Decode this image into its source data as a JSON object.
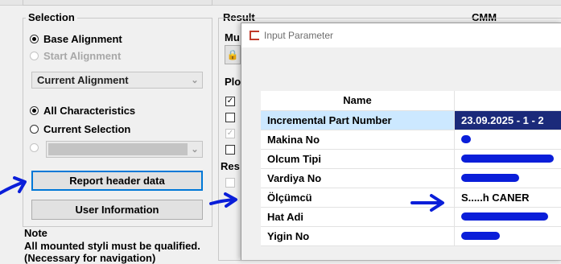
{
  "selection": {
    "title": "Selection",
    "base_alignment": "Base Alignment",
    "start_alignment": "Start Alignment",
    "alignment_combo": "Current Alignment",
    "all_characteristics": "All Characteristics",
    "current_selection": "Current Selection",
    "report_header_button": "Report header data",
    "user_info_button": "User Information"
  },
  "result": {
    "title": "Result",
    "mu_label": "Mu",
    "plot_label": "Plo",
    "res_label": "Res"
  },
  "cmm": {
    "title": "CMM"
  },
  "note": {
    "title": "Note",
    "line1": "All mounted styli must be qualified.",
    "line2": "(Necessary for navigation)"
  },
  "dialog": {
    "title": "Input Parameter",
    "header_name": "Name",
    "header_value": "",
    "rows": [
      {
        "name": "Incremental Part Number",
        "value": "23.09.2025 - 1 - 2"
      },
      {
        "name": "Makina No",
        "value": ""
      },
      {
        "name": "Olcum Tipi",
        "value": ""
      },
      {
        "name": "Vardiya No",
        "value": ""
      },
      {
        "name": "Ölçümcü",
        "value": "S.....h CANER"
      },
      {
        "name": "Hat Adi",
        "value": ""
      },
      {
        "name": "Yigin No",
        "value": ""
      }
    ]
  },
  "colors": {
    "accent": "#0078d7",
    "annotation": "#0a1ed9",
    "selected_row": "#cce8ff"
  }
}
